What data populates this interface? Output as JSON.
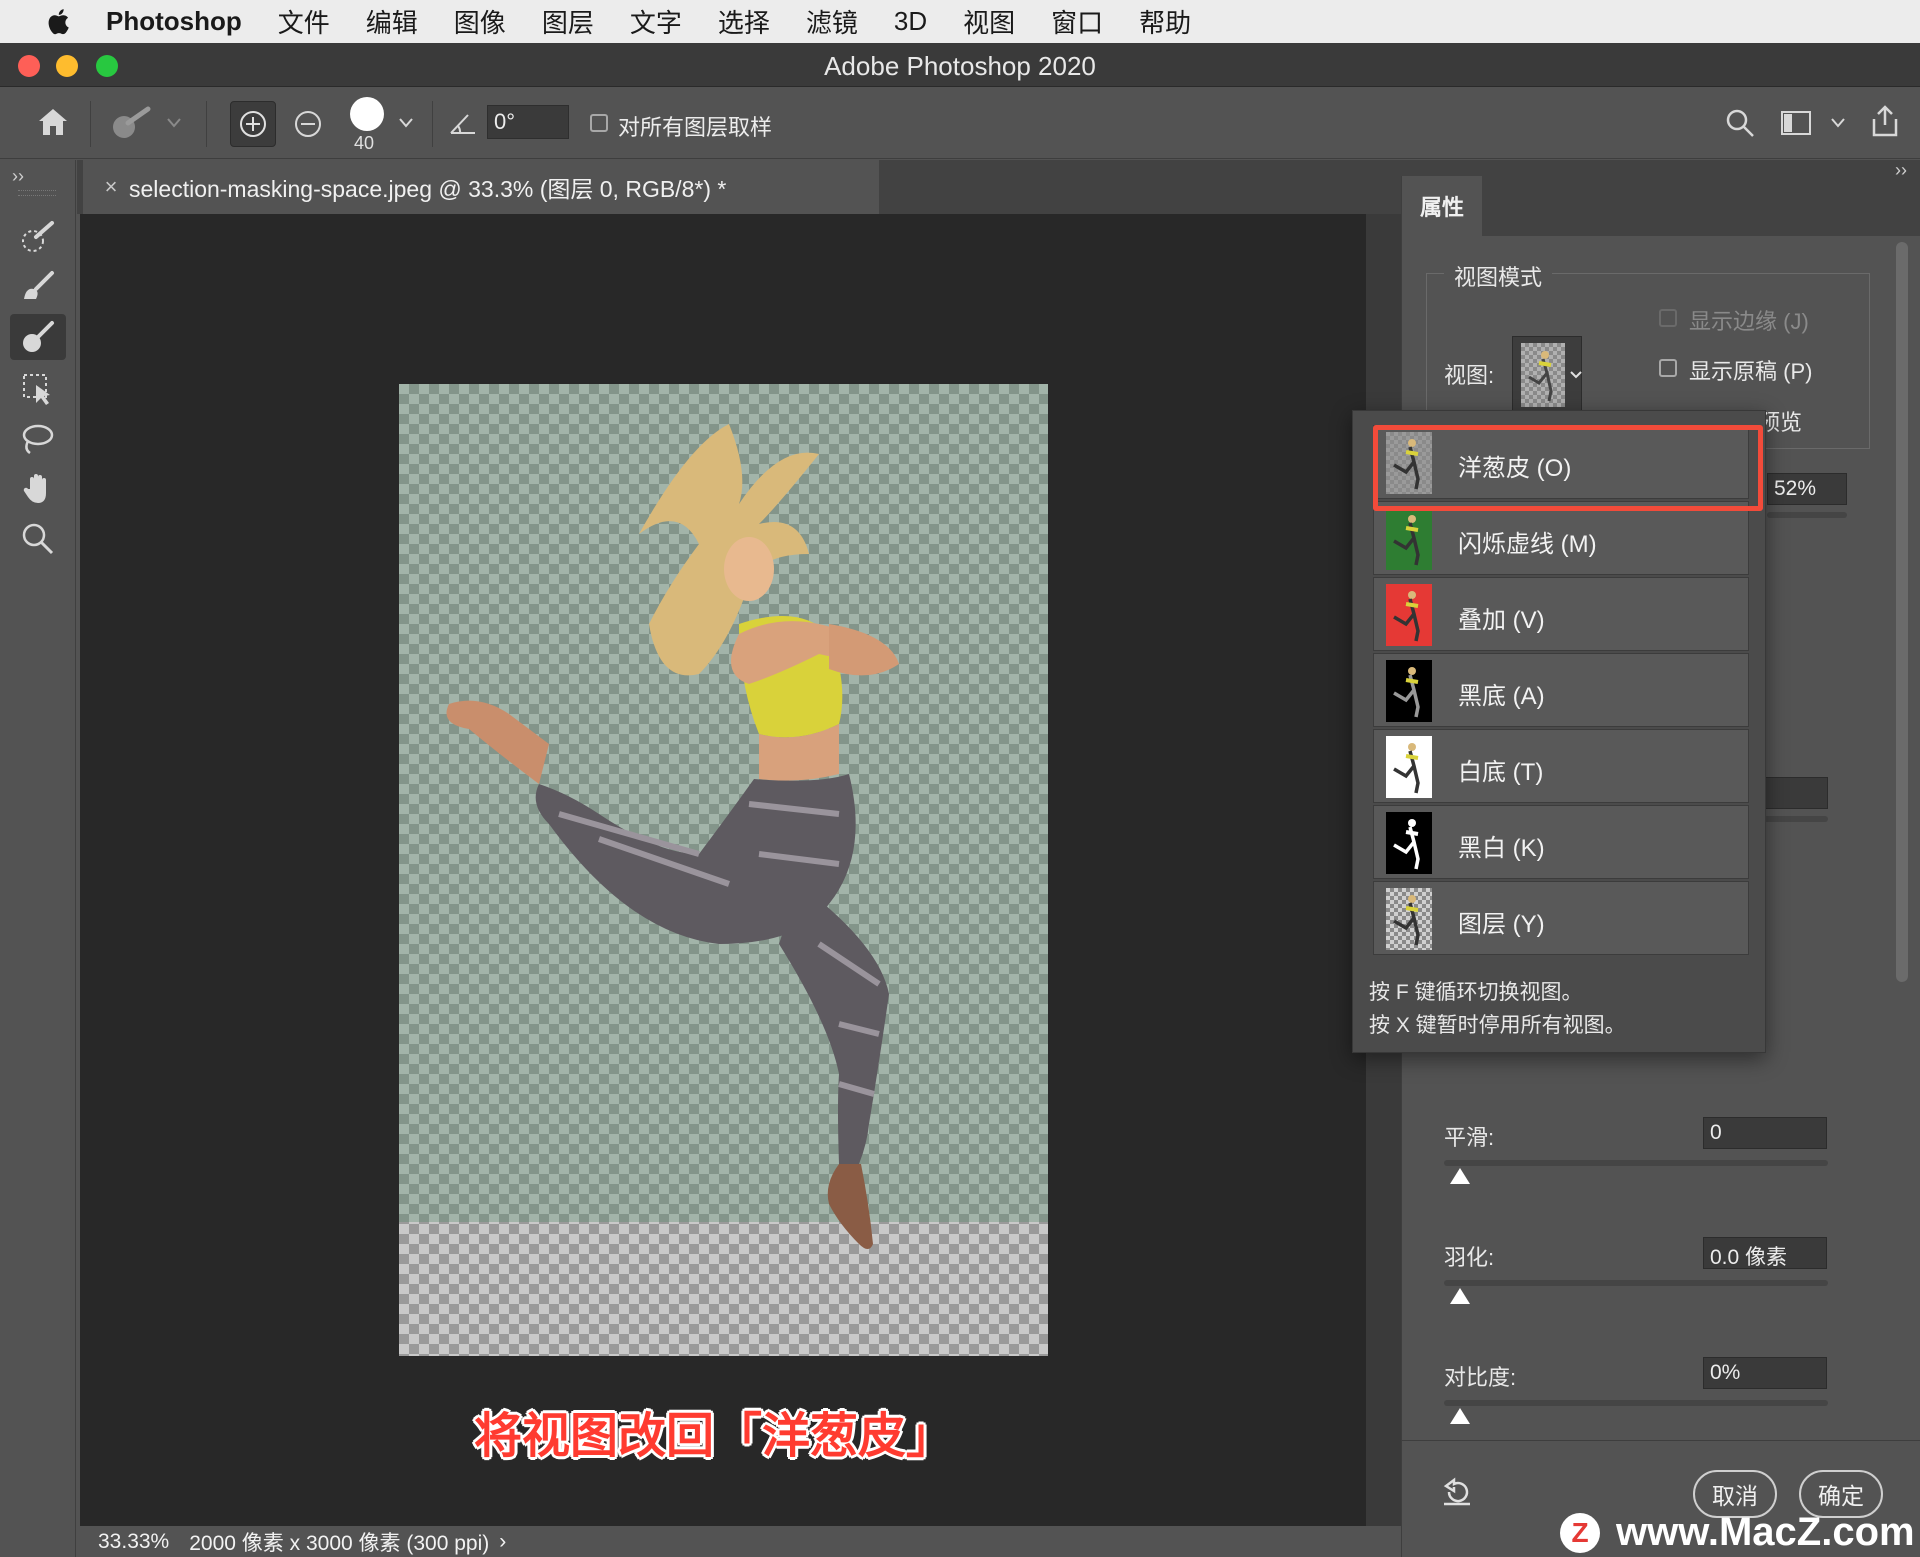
{
  "menubar": {
    "app": "Photoshop",
    "items": [
      "文件",
      "编辑",
      "图像",
      "图层",
      "文字",
      "选择",
      "滤镜",
      "3D",
      "视图",
      "窗口",
      "帮助"
    ]
  },
  "window": {
    "title": "Adobe Photoshop 2020"
  },
  "options": {
    "brush_size": "40",
    "angle": "0°",
    "sample_all_layers": "对所有图层取样"
  },
  "document": {
    "tab_title": "selection-masking-space.jpeg @ 33.3% (图层 0, RGB/8*) *",
    "zoom": "33.33%",
    "info": "2000 像素 x 3000 像素 (300 ppi)"
  },
  "caption": "将视图改回「洋葱皮」",
  "properties": {
    "tab": "属性",
    "view_mode_title": "视图模式",
    "view_label": "视图:",
    "show_edge": "显示边缘 (J)",
    "show_original": "显示原稿 (P)",
    "preview_fragment": "预览",
    "percent": "52%",
    "smooth_label": "平滑:",
    "smooth_value": "0",
    "feather_label": "羽化:",
    "feather_value": "0.0 像素",
    "contrast_label": "对比度:",
    "contrast_value": "0%",
    "cancel": "取消",
    "ok": "确定"
  },
  "view_menu": {
    "items": [
      {
        "label": "洋葱皮 (O)",
        "bg": "#9a9a9a"
      },
      {
        "label": "闪烁虚线 (M)",
        "bg": "#2e7d32"
      },
      {
        "label": "叠加 (V)",
        "bg": "#e53935"
      },
      {
        "label": "黑底 (A)",
        "bg": "#000000"
      },
      {
        "label": "白底 (T)",
        "bg": "#ffffff"
      },
      {
        "label": "黑白 (K)",
        "bg": "#000000"
      },
      {
        "label": "图层 (Y)",
        "bg": "#d0d0d0"
      }
    ],
    "hint1": "按 F 键循环切换视图。",
    "hint2": "按 X 键暂时停用所有视图。"
  },
  "watermark": "www.MacZ.com",
  "colors": {
    "highlight": "#f24b3a",
    "caption": "#ff3b30"
  }
}
